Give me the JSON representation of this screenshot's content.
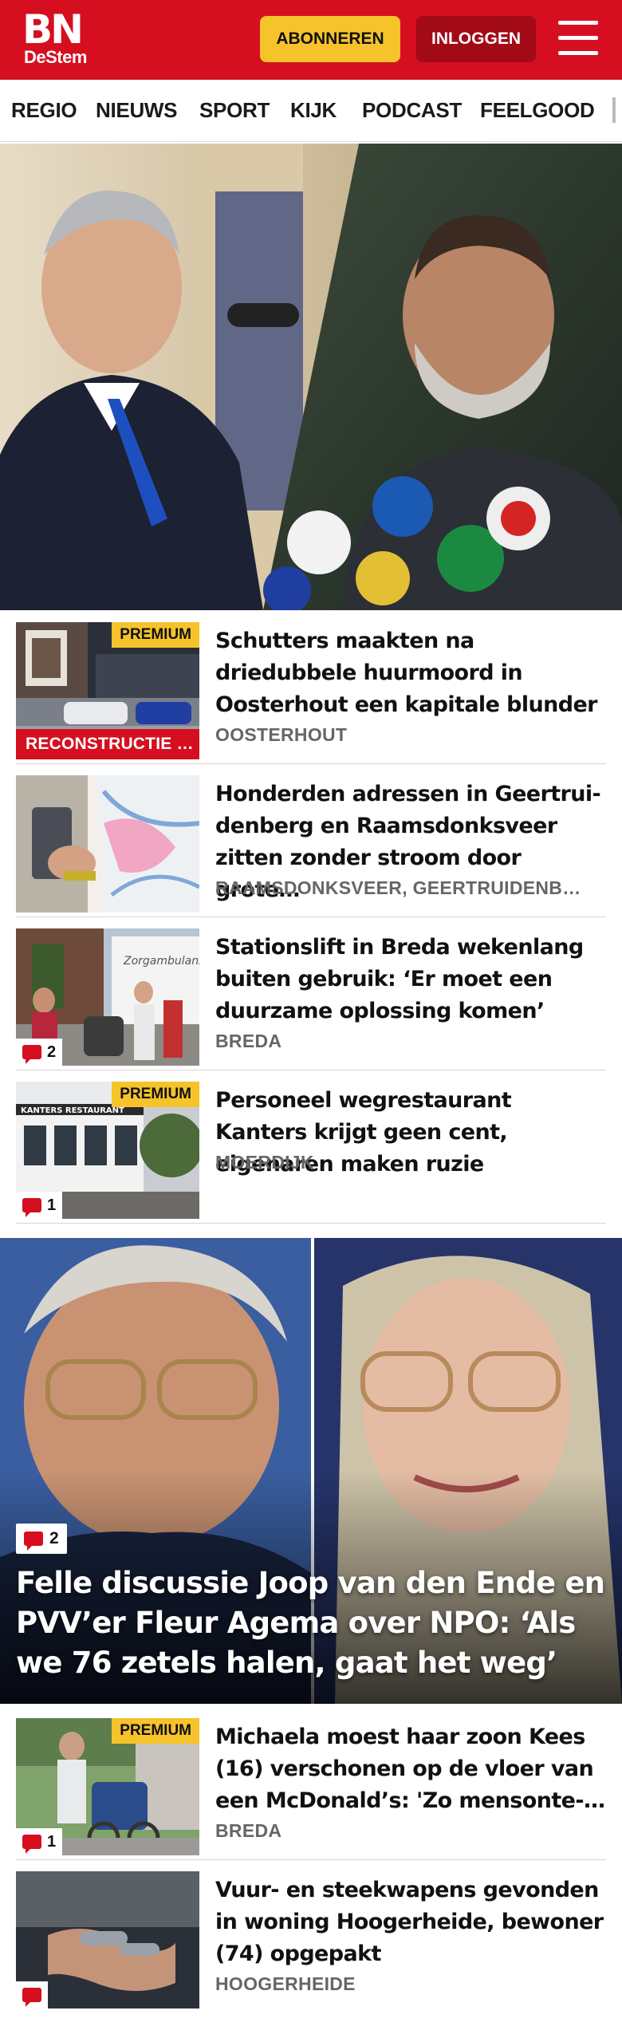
{
  "header": {
    "logo_main": "BN",
    "logo_sub": "DeStem",
    "subscribe_label": "ABONNEREN",
    "login_label": "INLOGGEN",
    "menu_icon": "hamburger-menu-icon",
    "brand_color": "#d50f1f",
    "accent_color": "#f6c32b"
  },
  "nav": {
    "items": [
      {
        "label": "REGIO"
      },
      {
        "label": "NIEUWS"
      },
      {
        "label": "SPORT"
      },
      {
        "label": "KIJK"
      },
      {
        "label": "PODCAST"
      },
      {
        "label": "FEELGOOD"
      }
    ]
  },
  "articles": [
    {
      "title": "Schutters maakten na driedubbele huurmoord in Oosterhout een kapitale blunder",
      "location": "OOSTERHOUT",
      "premium_label": "PREMIUM",
      "tag_label": "RECONSTRUCTIE …"
    },
    {
      "title": "Honderden adressen in Geertrui­denberg en Raamsdonksveer zitten zonder stroom door grote…",
      "location": "RAAMSDONKSVEER, GEERTRUIDENB…"
    },
    {
      "title": "Stationslift in Breda wekenlang buiten gebruik: ‘Er moet een duurzame oplossing komen’",
      "location": "BREDA",
      "comment_count": "2"
    },
    {
      "title": "Personeel wegrestaurant Kanters krijgt geen cent, eigenaren maken ruzie",
      "location": "MOERDIJK",
      "premium_label": "PREMIUM",
      "comment_count": "1"
    }
  ],
  "feature": {
    "title": "Felle discussie Joop van den Ende en PVV’er Fleur Agema over NPO: ‘Als we 76 zetels halen, gaat het weg’",
    "comment_count": "2"
  },
  "articles_more": [
    {
      "title": "Michaela moest haar zoon Kees (16) verschonen op de vloer van een McDonald’s: 'Zo mensonte-…",
      "location": "BREDA",
      "premium_label": "PREMIUM",
      "comment_count": "1"
    },
    {
      "title": "Vuur- en steekwapens gevonden in woning Hoogerheide, bewoner (74) opgepakt",
      "location": "HOOGERHEIDE"
    }
  ]
}
